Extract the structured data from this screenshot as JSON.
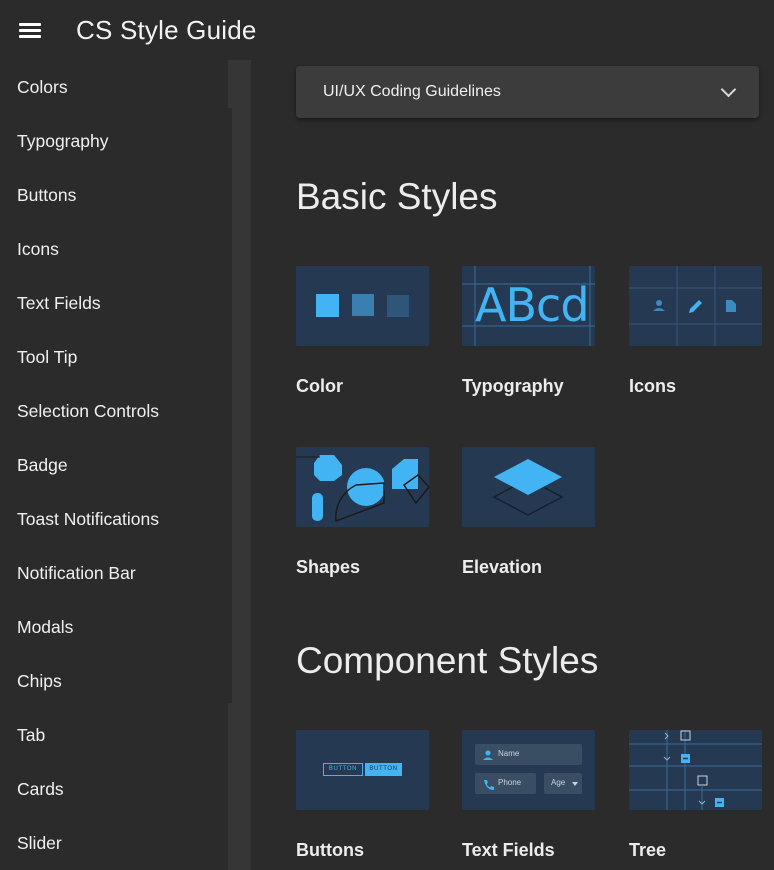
{
  "app": {
    "title": "CS Style Guide"
  },
  "sidebar": {
    "items": [
      {
        "label": "Colors"
      },
      {
        "label": "Typography"
      },
      {
        "label": "Buttons"
      },
      {
        "label": "Icons"
      },
      {
        "label": "Text Fields"
      },
      {
        "label": "Tool Tip"
      },
      {
        "label": "Selection Controls"
      },
      {
        "label": "Badge"
      },
      {
        "label": "Toast Notifications"
      },
      {
        "label": "Notification Bar"
      },
      {
        "label": "Modals"
      },
      {
        "label": "Chips"
      },
      {
        "label": "Tab"
      },
      {
        "label": "Cards"
      },
      {
        "label": "Slider"
      }
    ]
  },
  "main": {
    "dropdown": {
      "label": "UI/UX Coding Guidelines"
    },
    "basic": {
      "title": "Basic Styles",
      "cards": [
        {
          "label": "Color"
        },
        {
          "label": "Typography",
          "sample": "ABcd"
        },
        {
          "label": "Icons"
        },
        {
          "label": "Shapes"
        },
        {
          "label": "Elevation"
        }
      ]
    },
    "component": {
      "title": "Component Styles",
      "cards": [
        {
          "label": "Buttons",
          "btn_outline": "BUTTON",
          "btn_filled": "BUTTON"
        },
        {
          "label": "Text Fields",
          "field_name": "Name",
          "field_phone": "Phone",
          "field_age": "Age"
        },
        {
          "label": "Tree"
        }
      ]
    }
  },
  "colors": {
    "background": "#2b2b2b",
    "tile": "#253a52",
    "accent": "#42b4f4",
    "accent_mid": "#3a7fb0",
    "accent_dark": "#2f5578"
  }
}
